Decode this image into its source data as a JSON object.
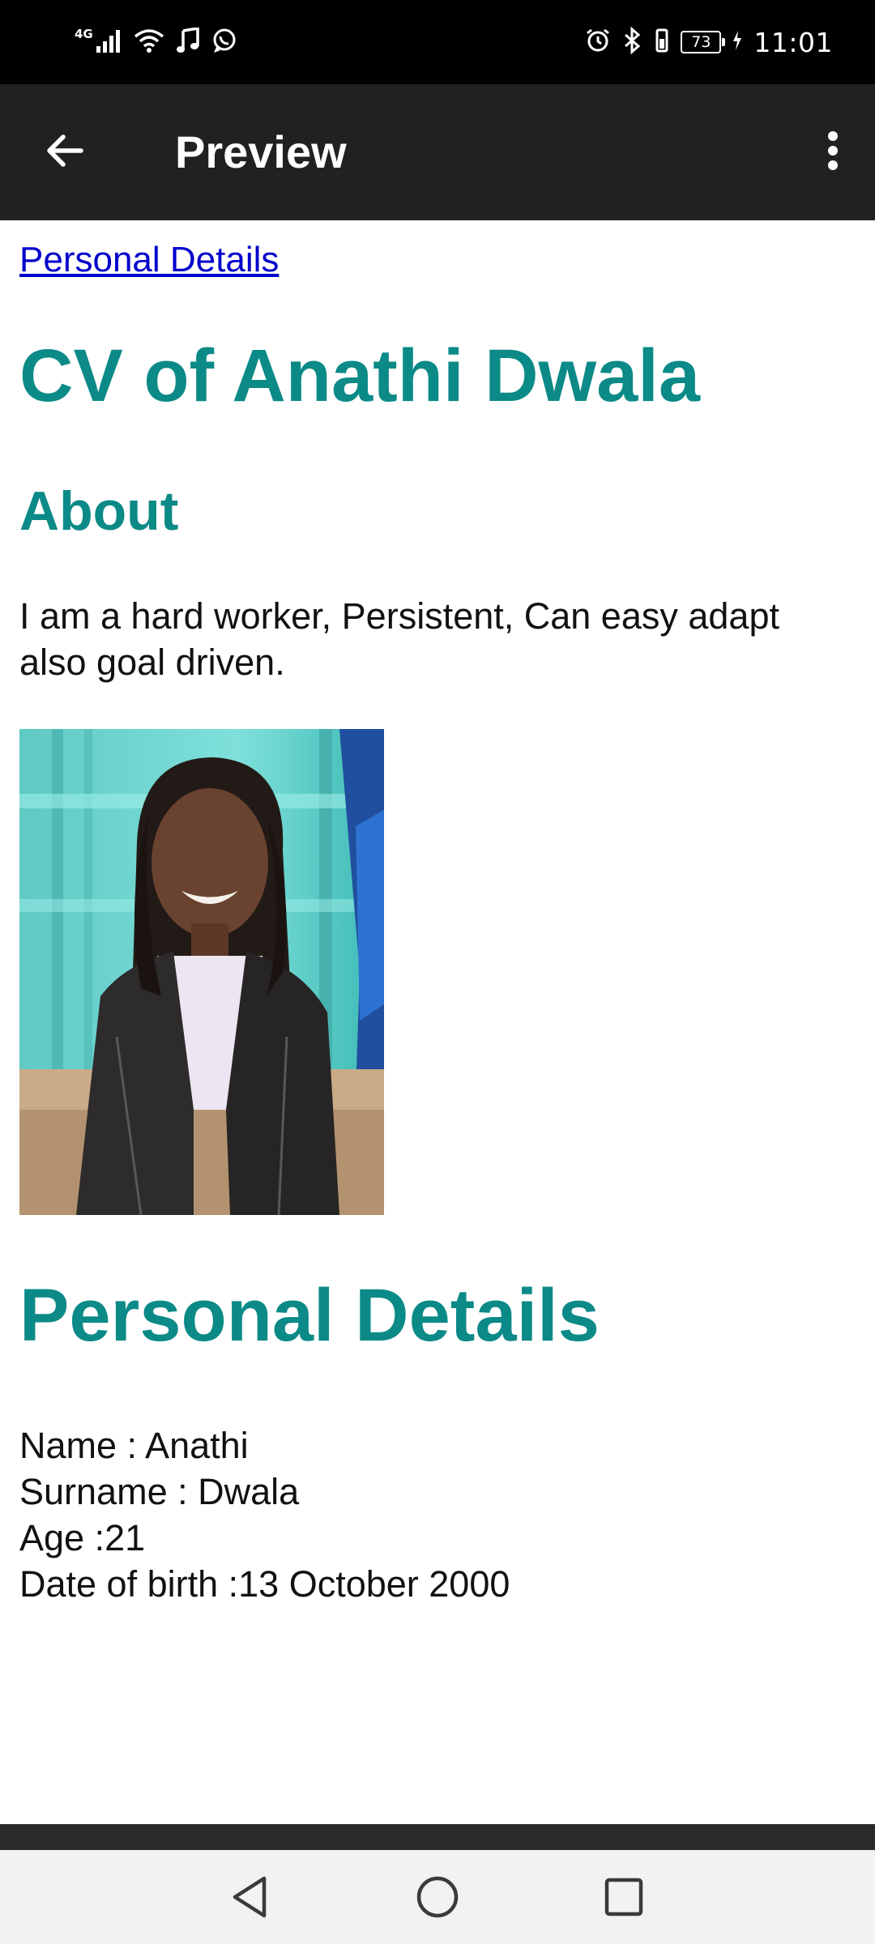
{
  "status_bar": {
    "network": "4G",
    "battery_level": "73",
    "time": "11:01"
  },
  "app_bar": {
    "title": "Preview"
  },
  "content": {
    "nav_link": "Personal Details",
    "cv_heading": "CV of Anathi Dwala",
    "about_heading": "About",
    "about_text": "I am a hard worker, Persistent, Can easy adapt also goal driven.",
    "personal_heading": "Personal Details",
    "details": [
      "Name : Anathi",
      "Surname : Dwala",
      "Age :21",
      "Date of birth :13 October 2000"
    ]
  },
  "colors": {
    "heading_teal": "#0b8a87",
    "link_blue": "#0000cc",
    "app_bar_bg": "#212121",
    "status_bar_bg": "#000000",
    "nav_bar_bg": "#f2f2f2"
  },
  "icons": {
    "back": "arrow-left-icon",
    "overflow": "more-vertical-icon",
    "nav_back": "triangle-back-icon",
    "nav_home": "circle-home-icon",
    "nav_recents": "square-recents-icon"
  }
}
